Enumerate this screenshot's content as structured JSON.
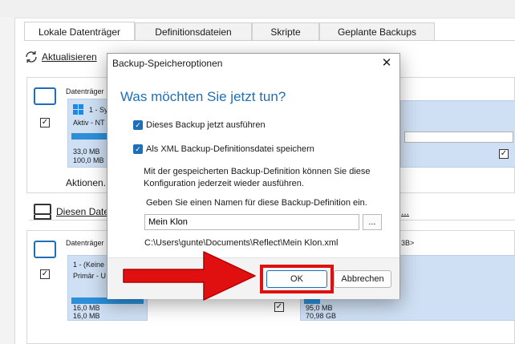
{
  "tabs": [
    {
      "label": "Lokale Datenträger",
      "active": true
    },
    {
      "label": "Definitionsdateien",
      "active": false
    },
    {
      "label": "Skripte",
      "active": false
    },
    {
      "label": "Geplante Backups",
      "active": false
    }
  ],
  "refresh": {
    "label": "Aktualisieren"
  },
  "disk1": {
    "header": "Datenträger",
    "partition": {
      "name": "1 - Sy",
      "type": "Aktiv - NT",
      "used": "33,0 MB",
      "total": "100,0 MB"
    },
    "actions": "Aktionen..."
  },
  "section2": {
    "label": "Diesen Dater",
    "link_tail": "..."
  },
  "disk2": {
    "header": "Datenträger",
    "header_tail": "3B>",
    "partition1": {
      "name": "1 -  (Keine",
      "type": "Primär - U",
      "used": "16,0 MB",
      "total": "16,0 MB"
    },
    "partition2": {
      "used": "95,0 MB",
      "total": "70,98 GB"
    }
  },
  "dialog": {
    "title": "Backup-Speicheroptionen",
    "close_glyph": "✕",
    "heading": "Was möchten Sie jetzt tun?",
    "options": [
      {
        "label": "Dieses Backup jetzt ausführen",
        "checked": true
      },
      {
        "label": "Als XML Backup-Definitionsdatei speichern",
        "checked": true
      }
    ],
    "info": "Mit der gespeicherten Backup-Definition können Sie diese Konfiguration jederzeit wieder ausführen.",
    "prompt": "Geben Sie einen Namen für diese Backup-Definition ein.",
    "name_value": "Mein Klon",
    "browse_label": "...",
    "path": "C:\\Users\\gunte\\Documents\\Reflect\\Mein Klon.xml",
    "ok_label": "OK",
    "cancel_label": "Abbrechen"
  },
  "colors": {
    "accent": "#1e6fb8",
    "annotation": "#e01010"
  }
}
